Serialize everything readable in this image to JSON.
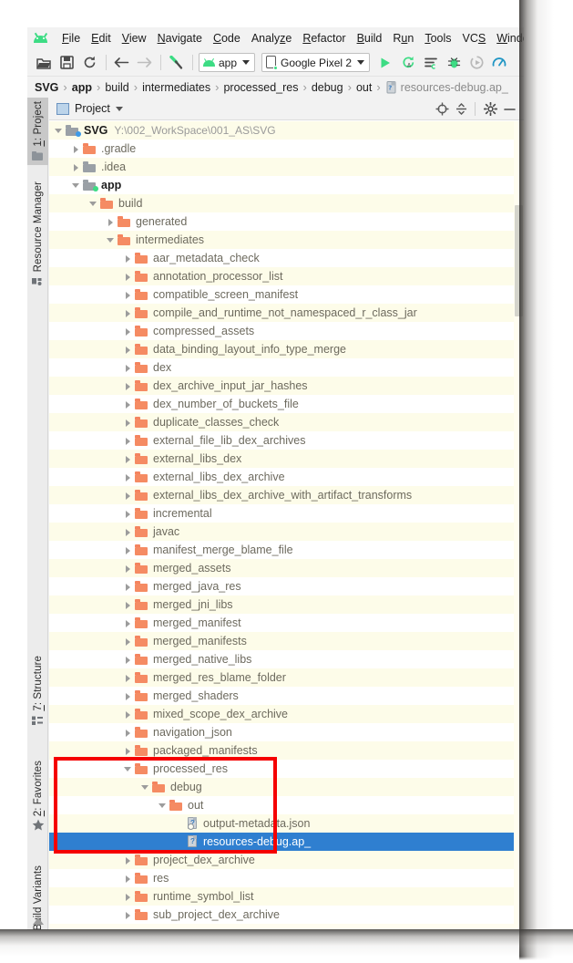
{
  "window": {
    "app_name": "Android Studio",
    "logo_icon": "android-droid-icon"
  },
  "menubar": {
    "items": [
      {
        "label": "File",
        "mnemonic": "F"
      },
      {
        "label": "Edit",
        "mnemonic": "E"
      },
      {
        "label": "View",
        "mnemonic": "V"
      },
      {
        "label": "Navigate",
        "mnemonic": "N"
      },
      {
        "label": "Code",
        "mnemonic": "C"
      },
      {
        "label": "Analyze",
        "mnemonic": "z"
      },
      {
        "label": "Refactor",
        "mnemonic": "R"
      },
      {
        "label": "Build",
        "mnemonic": "B"
      },
      {
        "label": "Run",
        "mnemonic": "u"
      },
      {
        "label": "Tools",
        "mnemonic": "T"
      },
      {
        "label": "VCS",
        "mnemonic": "S"
      },
      {
        "label": "Windo",
        "mnemonic": "W"
      }
    ]
  },
  "toolbar": {
    "icons": [
      {
        "name": "open-folder-icon",
        "title": "Open"
      },
      {
        "name": "save-all-icon",
        "title": "Save All"
      },
      {
        "name": "sync-project-icon",
        "title": "Sync Project with Gradle Files"
      },
      {
        "name": "navigate-back-icon",
        "title": "Back"
      },
      {
        "name": "navigate-forward-icon",
        "title": "Forward"
      },
      {
        "name": "build-hammer-icon",
        "title": "Make Project"
      }
    ],
    "run_config": {
      "label": "app",
      "icon": "android-module-icon"
    },
    "device_selector": {
      "label": "Google Pixel 2",
      "icon": "phone-device-icon"
    },
    "right_icons": [
      {
        "name": "run-icon",
        "title": "Run"
      },
      {
        "name": "apply-changes-icon",
        "title": "Apply Changes"
      },
      {
        "name": "apply-code-changes-icon",
        "title": "Apply Code Changes"
      },
      {
        "name": "debug-icon",
        "title": "Debug"
      },
      {
        "name": "run-coverage-icon",
        "title": "Run with Coverage"
      },
      {
        "name": "profiler-icon",
        "title": "Profile"
      }
    ]
  },
  "breadcrumb": {
    "items": [
      {
        "label": "SVG",
        "style": "bold"
      },
      {
        "label": "app",
        "style": "bold"
      },
      {
        "label": "build",
        "style": "normal"
      },
      {
        "label": "intermediates",
        "style": "normal"
      },
      {
        "label": "processed_res",
        "style": "normal"
      },
      {
        "label": "debug",
        "style": "normal"
      },
      {
        "label": "out",
        "style": "normal"
      },
      {
        "label": "resources-debug.ap_",
        "style": "dim",
        "icon": "archive-file-icon"
      }
    ],
    "separator": "›"
  },
  "left_rail": {
    "top_buttons": [
      {
        "label": "1: Project",
        "mnemonic": "1",
        "icon": "project-folder-icon",
        "active": true
      },
      {
        "label": "Resource Manager",
        "mnemonic": "",
        "icon": "resource-manager-icon",
        "active": false
      }
    ],
    "bottom_buttons": [
      {
        "label": "7: Structure",
        "mnemonic": "7",
        "icon": "structure-icon",
        "active": false
      },
      {
        "label": "2: Favorites",
        "mnemonic": "2",
        "icon": "star-icon",
        "active": false
      },
      {
        "label": "Build Variants",
        "mnemonic": "",
        "icon": "android-variant-icon",
        "active": false
      }
    ]
  },
  "tool_window": {
    "title": "Project",
    "icon": "project-view-icon",
    "dropdown_icon": "chevron-down-icon",
    "actions": [
      {
        "name": "scroll-from-source-icon",
        "title": "Select Opened File"
      },
      {
        "name": "collapse-all-icon",
        "title": "Collapse All"
      },
      {
        "name": "settings-gear-icon",
        "title": "Settings"
      },
      {
        "name": "hide-icon",
        "title": "Hide"
      }
    ]
  },
  "tree": {
    "rows": [
      {
        "indent": 0,
        "arrow": "open",
        "icon": "module-folder-icon",
        "icon_style": "mod",
        "badge": "blue",
        "label": "SVG",
        "bold": true,
        "path": "Y:\\002_WorkSpace\\001_AS\\SVG"
      },
      {
        "indent": 1,
        "arrow": "closed",
        "icon": "folder-icon",
        "icon_style": "orange",
        "label": ".gradle"
      },
      {
        "indent": 1,
        "arrow": "closed",
        "icon": "folder-icon",
        "icon_style": "gray",
        "label": ".idea"
      },
      {
        "indent": 1,
        "arrow": "open",
        "icon": "module-folder-icon",
        "icon_style": "mod",
        "badge": "green",
        "label": "app",
        "bold": true
      },
      {
        "indent": 2,
        "arrow": "open",
        "icon": "folder-icon",
        "icon_style": "orange",
        "label": "build"
      },
      {
        "indent": 3,
        "arrow": "closed",
        "icon": "folder-icon",
        "icon_style": "orange",
        "label": "generated"
      },
      {
        "indent": 3,
        "arrow": "open",
        "icon": "folder-icon",
        "icon_style": "orange",
        "label": "intermediates"
      },
      {
        "indent": 4,
        "arrow": "closed",
        "icon": "folder-icon",
        "icon_style": "orange",
        "label": "aar_metadata_check"
      },
      {
        "indent": 4,
        "arrow": "closed",
        "icon": "folder-icon",
        "icon_style": "orange",
        "label": "annotation_processor_list"
      },
      {
        "indent": 4,
        "arrow": "closed",
        "icon": "folder-icon",
        "icon_style": "orange",
        "label": "compatible_screen_manifest"
      },
      {
        "indent": 4,
        "arrow": "closed",
        "icon": "folder-icon",
        "icon_style": "orange",
        "label": "compile_and_runtime_not_namespaced_r_class_jar"
      },
      {
        "indent": 4,
        "arrow": "closed",
        "icon": "folder-icon",
        "icon_style": "orange",
        "label": "compressed_assets"
      },
      {
        "indent": 4,
        "arrow": "closed",
        "icon": "folder-icon",
        "icon_style": "orange",
        "label": "data_binding_layout_info_type_merge"
      },
      {
        "indent": 4,
        "arrow": "closed",
        "icon": "folder-icon",
        "icon_style": "orange",
        "label": "dex"
      },
      {
        "indent": 4,
        "arrow": "closed",
        "icon": "folder-icon",
        "icon_style": "orange",
        "label": "dex_archive_input_jar_hashes"
      },
      {
        "indent": 4,
        "arrow": "closed",
        "icon": "folder-icon",
        "icon_style": "orange",
        "label": "dex_number_of_buckets_file"
      },
      {
        "indent": 4,
        "arrow": "closed",
        "icon": "folder-icon",
        "icon_style": "orange",
        "label": "duplicate_classes_check"
      },
      {
        "indent": 4,
        "arrow": "closed",
        "icon": "folder-icon",
        "icon_style": "orange",
        "label": "external_file_lib_dex_archives"
      },
      {
        "indent": 4,
        "arrow": "closed",
        "icon": "folder-icon",
        "icon_style": "orange",
        "label": "external_libs_dex"
      },
      {
        "indent": 4,
        "arrow": "closed",
        "icon": "folder-icon",
        "icon_style": "orange",
        "label": "external_libs_dex_archive"
      },
      {
        "indent": 4,
        "arrow": "closed",
        "icon": "folder-icon",
        "icon_style": "orange",
        "label": "external_libs_dex_archive_with_artifact_transforms"
      },
      {
        "indent": 4,
        "arrow": "closed",
        "icon": "folder-icon",
        "icon_style": "orange",
        "label": "incremental"
      },
      {
        "indent": 4,
        "arrow": "closed",
        "icon": "folder-icon",
        "icon_style": "orange",
        "label": "javac"
      },
      {
        "indent": 4,
        "arrow": "closed",
        "icon": "folder-icon",
        "icon_style": "orange",
        "label": "manifest_merge_blame_file"
      },
      {
        "indent": 4,
        "arrow": "closed",
        "icon": "folder-icon",
        "icon_style": "orange",
        "label": "merged_assets"
      },
      {
        "indent": 4,
        "arrow": "closed",
        "icon": "folder-icon",
        "icon_style": "orange",
        "label": "merged_java_res"
      },
      {
        "indent": 4,
        "arrow": "closed",
        "icon": "folder-icon",
        "icon_style": "orange",
        "label": "merged_jni_libs"
      },
      {
        "indent": 4,
        "arrow": "closed",
        "icon": "folder-icon",
        "icon_style": "orange",
        "label": "merged_manifest"
      },
      {
        "indent": 4,
        "arrow": "closed",
        "icon": "folder-icon",
        "icon_style": "orange",
        "label": "merged_manifests"
      },
      {
        "indent": 4,
        "arrow": "closed",
        "icon": "folder-icon",
        "icon_style": "orange",
        "label": "merged_native_libs"
      },
      {
        "indent": 4,
        "arrow": "closed",
        "icon": "folder-icon",
        "icon_style": "orange",
        "label": "merged_res_blame_folder"
      },
      {
        "indent": 4,
        "arrow": "closed",
        "icon": "folder-icon",
        "icon_style": "orange",
        "label": "merged_shaders"
      },
      {
        "indent": 4,
        "arrow": "closed",
        "icon": "folder-icon",
        "icon_style": "orange",
        "label": "mixed_scope_dex_archive"
      },
      {
        "indent": 4,
        "arrow": "closed",
        "icon": "folder-icon",
        "icon_style": "orange",
        "label": "navigation_json"
      },
      {
        "indent": 4,
        "arrow": "closed",
        "icon": "folder-icon",
        "icon_style": "orange",
        "label": "packaged_manifests"
      },
      {
        "indent": 4,
        "arrow": "open",
        "icon": "folder-icon",
        "icon_style": "orange",
        "label": "processed_res"
      },
      {
        "indent": 5,
        "arrow": "open",
        "icon": "folder-icon",
        "icon_style": "orange",
        "label": "debug"
      },
      {
        "indent": 6,
        "arrow": "open",
        "icon": "folder-icon",
        "icon_style": "orange",
        "label": "out"
      },
      {
        "indent": 7,
        "arrow": "none",
        "icon": "json-file-icon",
        "label": "output-metadata.json"
      },
      {
        "indent": 7,
        "arrow": "none",
        "icon": "archive-file-icon",
        "label": "resources-debug.ap_",
        "selected": true
      },
      {
        "indent": 4,
        "arrow": "closed",
        "icon": "folder-icon",
        "icon_style": "orange",
        "label": "project_dex_archive"
      },
      {
        "indent": 4,
        "arrow": "closed",
        "icon": "folder-icon",
        "icon_style": "orange",
        "label": "res"
      },
      {
        "indent": 4,
        "arrow": "closed",
        "icon": "folder-icon",
        "icon_style": "orange",
        "label": "runtime_symbol_list"
      },
      {
        "indent": 4,
        "arrow": "closed",
        "icon": "folder-icon",
        "icon_style": "orange",
        "label": "sub_project_dex_archive"
      }
    ]
  },
  "annotation": {
    "highlight_box_color": "#f50000",
    "highlight_box_label": "processed_res-to-resources-debug-ap-highlight"
  },
  "colors": {
    "tree_background": "#fffdf0",
    "tree_row_alt": "#fdfce9",
    "selection_blue": "#2f7fd0",
    "folder_orange": "#f58b63",
    "folder_gray": "#9aa0a6",
    "accent_green": "#3ddc84",
    "chrome_gray": "#f2f2f2"
  }
}
